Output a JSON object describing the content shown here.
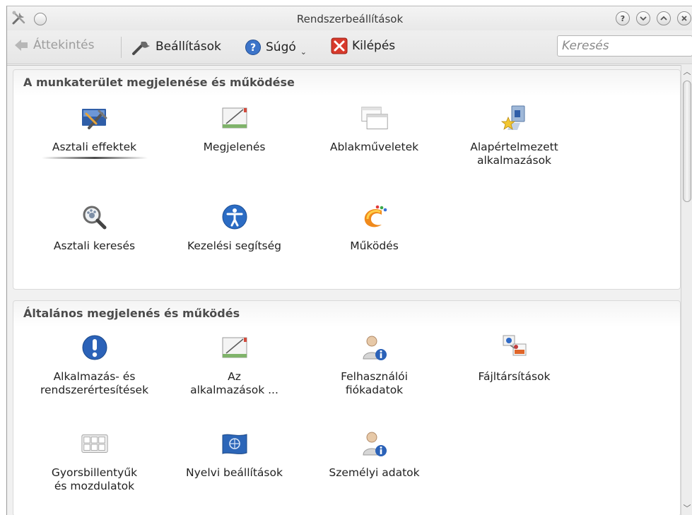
{
  "window": {
    "title": "Rendszerbeállítások"
  },
  "toolbar": {
    "overview_label": "Áttekintés",
    "settings_label": "Beállítások",
    "help_label": "Súgó",
    "quit_label": "Kilépés",
    "search_placeholder": "Keresés"
  },
  "sections": [
    {
      "title": "A munkaterület megjelenése és működése",
      "items": [
        {
          "label": "Asztali effektek",
          "label2": "",
          "icon": "desktop-effects-icon"
        },
        {
          "label": "Megjelenés",
          "label2": "",
          "icon": "appearance-icon"
        },
        {
          "label": "Ablakműveletek",
          "label2": "",
          "icon": "window-behavior-icon"
        },
        {
          "label": "Alapértelmezett",
          "label2": "alkalmazások",
          "icon": "default-apps-icon"
        },
        {
          "label": "Asztali keresés",
          "label2": "",
          "icon": "desktop-search-icon"
        },
        {
          "label": "Kezelési segítség",
          "label2": "",
          "icon": "accessibility-icon"
        },
        {
          "label": "Működés",
          "label2": "",
          "icon": "workspace-behavior-icon"
        }
      ]
    },
    {
      "title": "Általános megjelenés és működés",
      "items": [
        {
          "label": "Alkalmazás- és",
          "label2": "rendszerértesítések",
          "icon": "notifications-icon"
        },
        {
          "label": "Az",
          "label2": "alkalmazások ...",
          "icon": "application-appearance-icon"
        },
        {
          "label": "Felhasználói",
          "label2": "fiókadatok",
          "icon": "account-details-icon"
        },
        {
          "label": "Fájltársítások",
          "label2": "",
          "icon": "file-associations-icon"
        },
        {
          "label": "Gyorsbillentyűk",
          "label2": "és mozdulatok",
          "icon": "shortcuts-icon"
        },
        {
          "label": "Nyelvi beállítások",
          "label2": "",
          "icon": "locale-icon"
        },
        {
          "label": "Személyi adatok",
          "label2": "",
          "icon": "personal-info-icon"
        }
      ]
    }
  ]
}
